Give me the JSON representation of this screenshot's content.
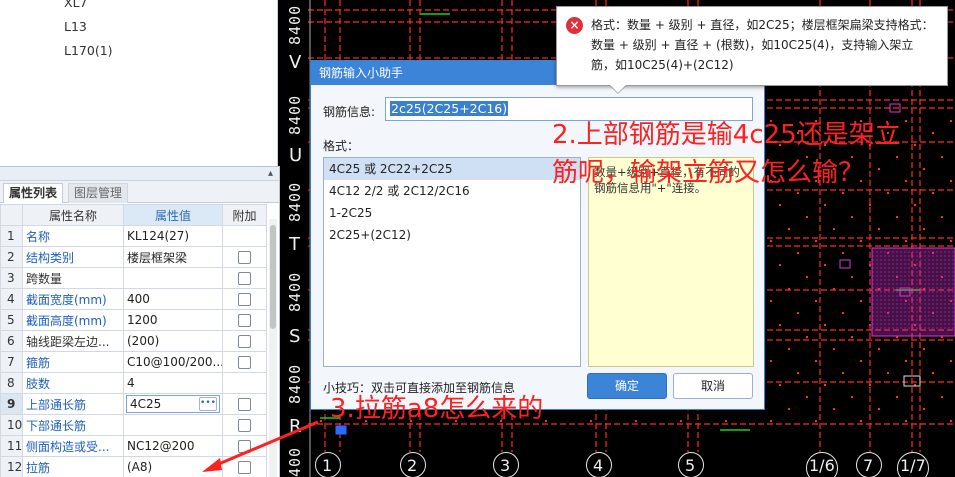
{
  "tree": {
    "items": [
      "XL7",
      "L13",
      "L170(1)"
    ]
  },
  "panel": {
    "tabs": [
      "属性列表",
      "图层管理"
    ],
    "columns": [
      "属性名称",
      "属性值",
      "附加"
    ],
    "rows": [
      {
        "idx": "1",
        "name": "名称",
        "value": "KL124(27)",
        "blue": true,
        "check": false
      },
      {
        "idx": "2",
        "name": "结构类别",
        "value": "楼层框架梁",
        "blue": true,
        "check": true
      },
      {
        "idx": "3",
        "name": "跨数量",
        "value": "",
        "blue": false,
        "check": true
      },
      {
        "idx": "4",
        "name": "截面宽度(mm)",
        "value": "400",
        "blue": true,
        "check": true
      },
      {
        "idx": "5",
        "name": "截面高度(mm)",
        "value": "1200",
        "blue": true,
        "check": true
      },
      {
        "idx": "6",
        "name": "轴线距梁左边...",
        "value": "(200)",
        "blue": false,
        "check": true
      },
      {
        "idx": "7",
        "name": "箍筋",
        "value": "C10@100/200...",
        "blue": true,
        "check": true
      },
      {
        "idx": "8",
        "name": "肢数",
        "value": "4",
        "blue": true,
        "check": false
      },
      {
        "idx": "9",
        "name": "上部通长筋",
        "value": "4C25",
        "blue": true,
        "check": true,
        "selected": true
      },
      {
        "idx": "10",
        "name": "下部通长筋",
        "value": "",
        "blue": true,
        "check": true
      },
      {
        "idx": "11",
        "name": "侧面构造或受...",
        "value": "NC12@200",
        "blue": true,
        "check": true
      },
      {
        "idx": "12",
        "name": "拉筋",
        "value": "(A8)",
        "blue": true,
        "check": true
      }
    ]
  },
  "cad": {
    "axis_letters": [
      "V",
      "U",
      "T",
      "S",
      "R"
    ],
    "dimension": "8400",
    "axis_numbers": [
      "1",
      "2",
      "3",
      "4",
      "5",
      "1/6",
      "7",
      "1/7"
    ],
    "axis_num_left": "1",
    "bottom_left_dim": "400"
  },
  "dialog": {
    "title": "钢筋输入小助手",
    "info_label": "钢筋信息:",
    "info_value": "2c25(2C25+2C16)",
    "format_label": "格式：",
    "formats": [
      "4C25 或 2C22+2C25",
      "4C12 2/2 或 2C12/2C16",
      "1-2C25",
      "2C25+(2C12)"
    ],
    "description": "数量+级别+直径，有不同的钢筋信息用\"+\"连接。",
    "tip": "小技巧：双击可直接添加至钢筋信息",
    "ok_label": "确定",
    "cancel_label": "取消"
  },
  "tooltip": {
    "text": "格式：数量 + 级别 + 直径，如2C25；楼层框架扁梁支持格式：数量 + 级别 + 直径 + (根数)，如10C25(4)，支持输入架立筋，如10C25(4)+(2C12)"
  },
  "annotations": {
    "q2_line1": "2.上部钢筋是输4c25还是架立",
    "q2_line2": "筋呢，输架立筋又怎么输？",
    "q3": "3.拉筋a8怎么来的"
  },
  "colors": {
    "dialog_title": "#3b84d8",
    "annotation": "#ff2020",
    "cad_red": "#ff2a2a",
    "cad_green": "#19d219",
    "cad_magenta": "#d838d8"
  }
}
